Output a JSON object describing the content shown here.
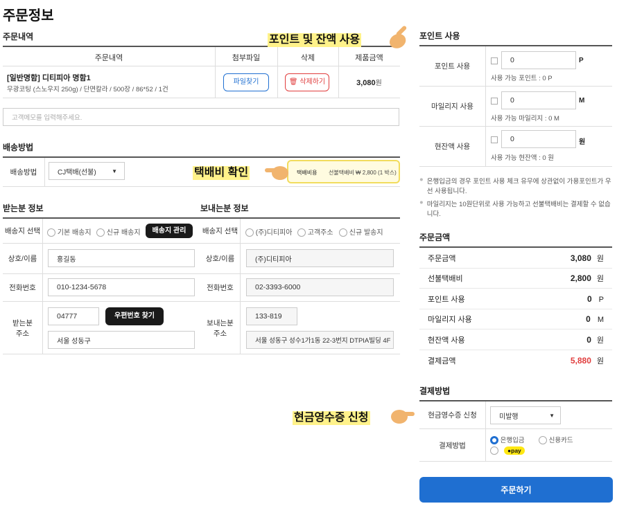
{
  "page_title": "주문정보",
  "order": {
    "section_title": "주문내역",
    "headers": [
      "주문내역",
      "첨부파일",
      "삭제",
      "제품금액"
    ],
    "product_name": "[일반명함] 디티피아 명함1",
    "product_desc": "무광코팅 (스노우지 250g) / 단면칼라 / 500장 / 86*52 / 1건",
    "attach_button": "파일찾기",
    "delete_button": "삭제하기",
    "price": "3,080",
    "price_unit": "원",
    "memo_placeholder": "고객메모를 입력해주세요."
  },
  "shipping": {
    "section_title": "배송방법",
    "label": "배송방법",
    "selected": "CJ택배(선불)",
    "fee_label": "택배비용",
    "fee_text": "선불택배비 ₩ 2,800 (1 박스)"
  },
  "receiver": {
    "section_title": "받는분 정보",
    "select_label": "배송지 선택",
    "options": [
      "기본 배송지",
      "신규 배송지"
    ],
    "manage_button": "배송지 관리",
    "name_label": "상호/이름",
    "name_value": "홍길동",
    "phone_label": "전화번호",
    "phone_value": "010-1234-5678",
    "address_label_1": "받는분",
    "address_label_2": "주소",
    "zip_value": "04777",
    "zip_button": "우편번호 찾기",
    "address_value": "서울 성동구"
  },
  "sender": {
    "section_title": "보내는분 정보",
    "select_label": "배송지 선택",
    "options": [
      "(주)디티피아",
      "고객주소",
      "신규 발송지"
    ],
    "name_label": "상호/이름",
    "name_value": "(주)디티피아",
    "phone_label": "전화번호",
    "phone_value": "02-3393-6000",
    "address_label_1": "보내는분",
    "address_label_2": "주소",
    "zip_value": "133-819",
    "address_value": "서울 성동구 성수1가1동 22-3번지 DTPIA빌딩 4F"
  },
  "points": {
    "section_title": "포인트 사용",
    "rows": [
      {
        "label": "포인트 사용",
        "value": "0",
        "unit": "P",
        "available": "사용 가능 포인트 : 0 P"
      },
      {
        "label": "마일리지 사용",
        "value": "0",
        "unit": "M",
        "available": "사용 가능 마일리지 : 0 M"
      },
      {
        "label": "현잔액 사용",
        "value": "0",
        "unit": "원",
        "available": "사용 가능 현잔액 : 0 원"
      }
    ],
    "note_1": "은행입금의 경우 포인트 사용 체크 유무에 상관없이 가용포인트가 우선 사용됩니다.",
    "note_2": "마일리지는 10원단위로 사용 가능하고 선불택배비는 결제할 수 없습니다."
  },
  "summary": {
    "section_title": "주문금액",
    "rows": [
      {
        "label": "주문금액",
        "value": "3,080",
        "unit": "원"
      },
      {
        "label": "선불택배비",
        "value": "2,800",
        "unit": "원"
      },
      {
        "label": "포인트 사용",
        "value": "0",
        "unit": "P"
      },
      {
        "label": "마일리지 사용",
        "value": "0",
        "unit": "M"
      },
      {
        "label": "현잔액 사용",
        "value": "0",
        "unit": "원"
      },
      {
        "label": "결제금액",
        "value": "5,880",
        "unit": "원"
      }
    ],
    "total_color": "#e03c3c"
  },
  "payment": {
    "section_title": "결제방법",
    "receipt_label": "현금영수증 신청",
    "receipt_selected": "미발행",
    "method_label": "결제방법",
    "methods": [
      "은행입금",
      "신용카드"
    ],
    "kakaopay": "pay",
    "order_button": "주문하기",
    "accent": "#1f6fd1"
  },
  "callouts": {
    "points": "포인트 및 잔액 사용",
    "shipping": "택배비 확인",
    "receipt": "현금영수증 신청"
  }
}
